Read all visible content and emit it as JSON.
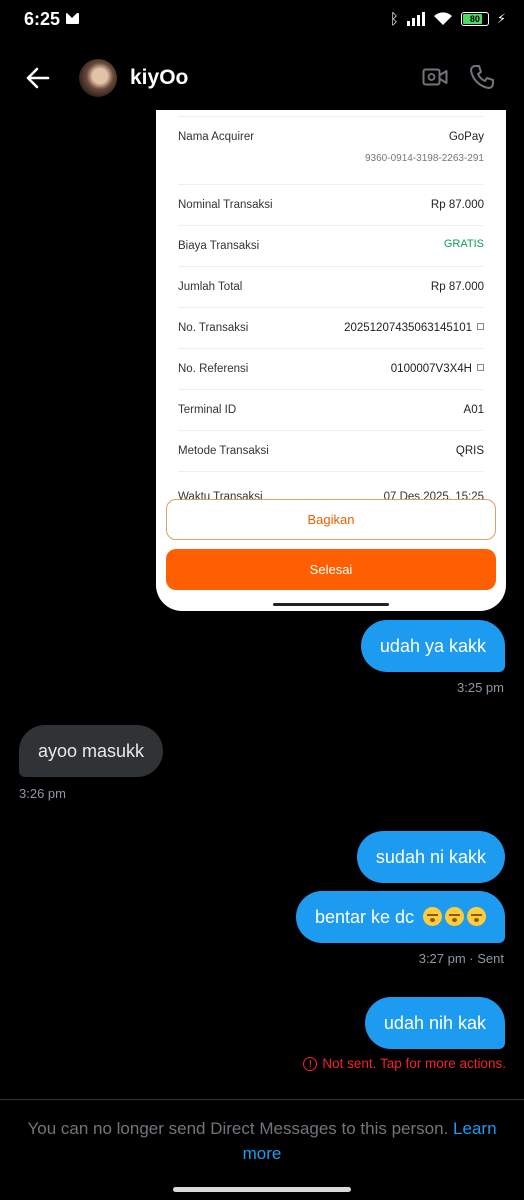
{
  "status_bar": {
    "time": "6:25",
    "battery": "80"
  },
  "header": {
    "contact_name": "kiyOo"
  },
  "receipt": {
    "rows": [
      {
        "label": "Nama Acquirer",
        "value": "GoPay",
        "sub": "9360-0914-3198-2263-291"
      },
      {
        "label": "Nominal Transaksi",
        "value": "Rp 87.000"
      },
      {
        "label": "Biaya Transaksi",
        "value": "GRATIS"
      },
      {
        "label": "Jumlah Total",
        "value": "Rp 87.000"
      },
      {
        "label": "No. Transaksi",
        "value": "20251207435063145101"
      },
      {
        "label": "No. Referensi",
        "value": "0100007V3X4H"
      },
      {
        "label": "Terminal ID",
        "value": "A01"
      },
      {
        "label": "Metode Transaksi",
        "value": "QRIS"
      },
      {
        "label": "Waktu Transaksi",
        "value": "07 Des 2025, 15:25"
      }
    ],
    "share_button": "Bagikan",
    "done_button": "Selesai"
  },
  "messages": [
    {
      "text": "udah ya kakk",
      "meta": "3:25 pm"
    },
    {
      "text": "ayoo masukk",
      "meta": "3:26 pm"
    },
    {
      "text": "sudah ni kakk"
    },
    {
      "text": "bentar ke dc",
      "meta": "3:27 pm · Sent"
    },
    {
      "text": "udah nih kak",
      "error": "Not sent. Tap for more actions."
    }
  ],
  "footer": {
    "note": "You can no longer send Direct Messages to this person.",
    "link": "Learn more"
  },
  "colors": {
    "accent": "#1d9bf0",
    "error": "#f4212e",
    "receipt_button": "#ff5f00"
  },
  "icons": [
    "mail-icon",
    "bluetooth-icon",
    "signal-icon",
    "wifi-icon",
    "battery-icon",
    "back-arrow-icon",
    "video-call-icon",
    "phone-call-icon",
    "copy-icon",
    "error-icon",
    "crying-emoji"
  ]
}
